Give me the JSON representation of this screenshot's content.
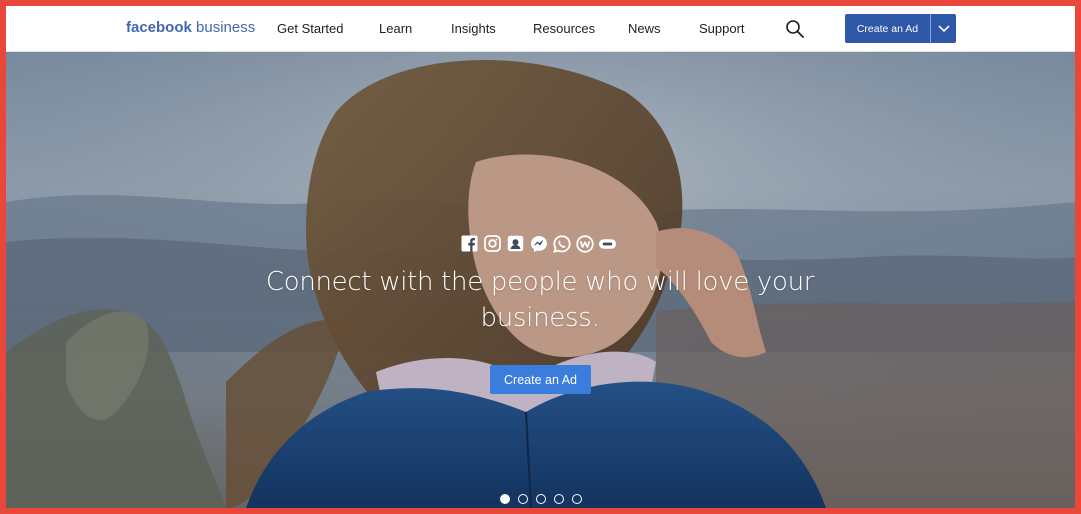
{
  "header": {
    "logo_brand": "facebook",
    "logo_suffix": "business",
    "nav": [
      {
        "label": "Get Started"
      },
      {
        "label": "Learn"
      },
      {
        "label": "Insights"
      },
      {
        "label": "Resources"
      },
      {
        "label": "News"
      },
      {
        "label": "Support"
      }
    ],
    "search_icon": "search-icon",
    "cta_label": "Create an Ad",
    "cta_dropdown_icon": "chevron-down-icon"
  },
  "hero": {
    "icons": [
      "facebook-icon",
      "instagram-icon",
      "audience-network-icon",
      "messenger-icon",
      "whatsapp-icon",
      "workplace-icon",
      "oculus-icon"
    ],
    "headline": "Connect with the people who will love your business.",
    "cta_label": "Create an Ad",
    "carousel": {
      "count": 5,
      "active_index": 0
    }
  },
  "colors": {
    "brand_blue": "#4267b2",
    "cta_dark": "#2e58a7",
    "cta_light": "#3b7ddd",
    "frame_red": "#e8473a"
  }
}
